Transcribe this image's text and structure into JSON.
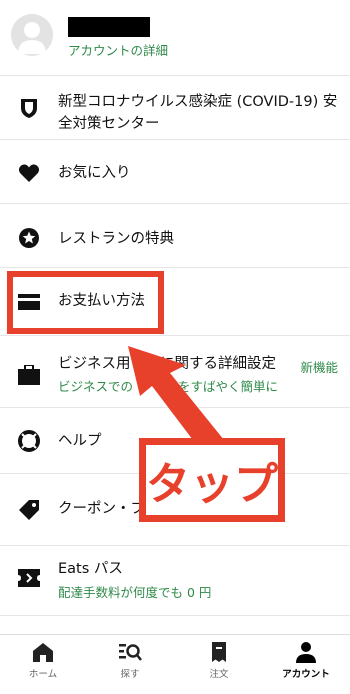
{
  "header": {
    "account_link": "アカウントの詳細"
  },
  "menu": {
    "covid_line1": "新型コロナウイルス感染症 (COVID-19) 安",
    "covid_line2": "全対策センター",
    "favorites": "お気に入り",
    "perks": "レストランの特典",
    "payment": "お支払い方法",
    "business_label": "ビジネス用",
    "business_label_end": "に関する詳細設定",
    "business_badge": "新機能",
    "business_sub_start": "ビジネスでの",
    "business_sub_end": "をすばやく簡単に",
    "help": "ヘルプ",
    "coupon": "クーポン・プ",
    "eats_pass": "Eats パス",
    "eats_pass_sub": "配達手数料が何度でも 0 円"
  },
  "annotation": {
    "callout_text": "タップ",
    "color": "#e8412b"
  },
  "tabbar": {
    "home": "ホーム",
    "search": "探す",
    "orders": "注文",
    "account": "アカウント"
  },
  "colors": {
    "accent_green": "#2f8a4a",
    "highlight_red": "#e8412b"
  }
}
